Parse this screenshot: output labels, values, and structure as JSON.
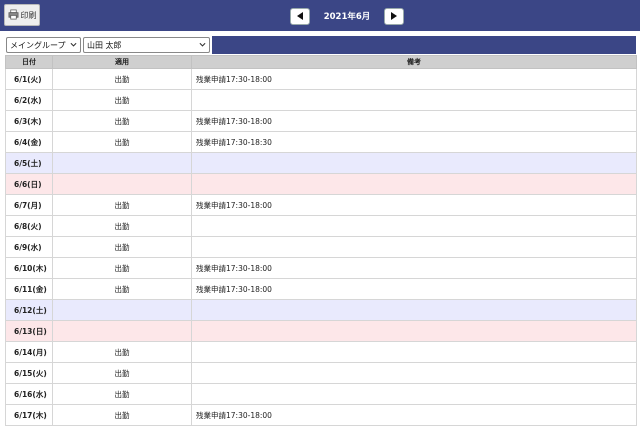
{
  "toolbar": {
    "print_label": "印刷",
    "print_icon": "printer-icon",
    "prev_icon": "triangle-left-icon",
    "next_icon": "triangle-right-icon",
    "month": "2021年6月"
  },
  "filters": {
    "group": "メイングループ",
    "user": "山田 太郎"
  },
  "table": {
    "headers": [
      "日付",
      "適用",
      "備考"
    ],
    "rows": [
      {
        "date": "6/1(火)",
        "app": "出勤",
        "note": "残業申請17:30-18:00",
        "kind": "weekday"
      },
      {
        "date": "6/2(水)",
        "app": "出勤",
        "note": "",
        "kind": "weekday"
      },
      {
        "date": "6/3(木)",
        "app": "出勤",
        "note": "残業申請17:30-18:00",
        "kind": "weekday"
      },
      {
        "date": "6/4(金)",
        "app": "出勤",
        "note": "残業申請17:30-18:30",
        "kind": "weekday"
      },
      {
        "date": "6/5(土)",
        "app": "",
        "note": "",
        "kind": "sat"
      },
      {
        "date": "6/6(日)",
        "app": "",
        "note": "",
        "kind": "sun"
      },
      {
        "date": "6/7(月)",
        "app": "出勤",
        "note": "残業申請17:30-18:00",
        "kind": "weekday"
      },
      {
        "date": "6/8(火)",
        "app": "出勤",
        "note": "",
        "kind": "weekday"
      },
      {
        "date": "6/9(水)",
        "app": "出勤",
        "note": "",
        "kind": "weekday"
      },
      {
        "date": "6/10(木)",
        "app": "出勤",
        "note": "残業申請17:30-18:00",
        "kind": "weekday"
      },
      {
        "date": "6/11(金)",
        "app": "出勤",
        "note": "残業申請17:30-18:00",
        "kind": "weekday"
      },
      {
        "date": "6/12(土)",
        "app": "",
        "note": "",
        "kind": "sat"
      },
      {
        "date": "6/13(日)",
        "app": "",
        "note": "",
        "kind": "sun"
      },
      {
        "date": "6/14(月)",
        "app": "出勤",
        "note": "",
        "kind": "weekday"
      },
      {
        "date": "6/15(火)",
        "app": "出勤",
        "note": "",
        "kind": "weekday"
      },
      {
        "date": "6/16(水)",
        "app": "出勤",
        "note": "",
        "kind": "weekday"
      },
      {
        "date": "6/17(木)",
        "app": "出勤",
        "note": "残業申請17:30-18:00",
        "kind": "weekday"
      }
    ]
  },
  "colors": {
    "header_bg": "#3b4686",
    "saturday_bg": "#e9eafd",
    "sunday_bg": "#fde7e9",
    "column_header_bg": "#cfcfcf"
  }
}
